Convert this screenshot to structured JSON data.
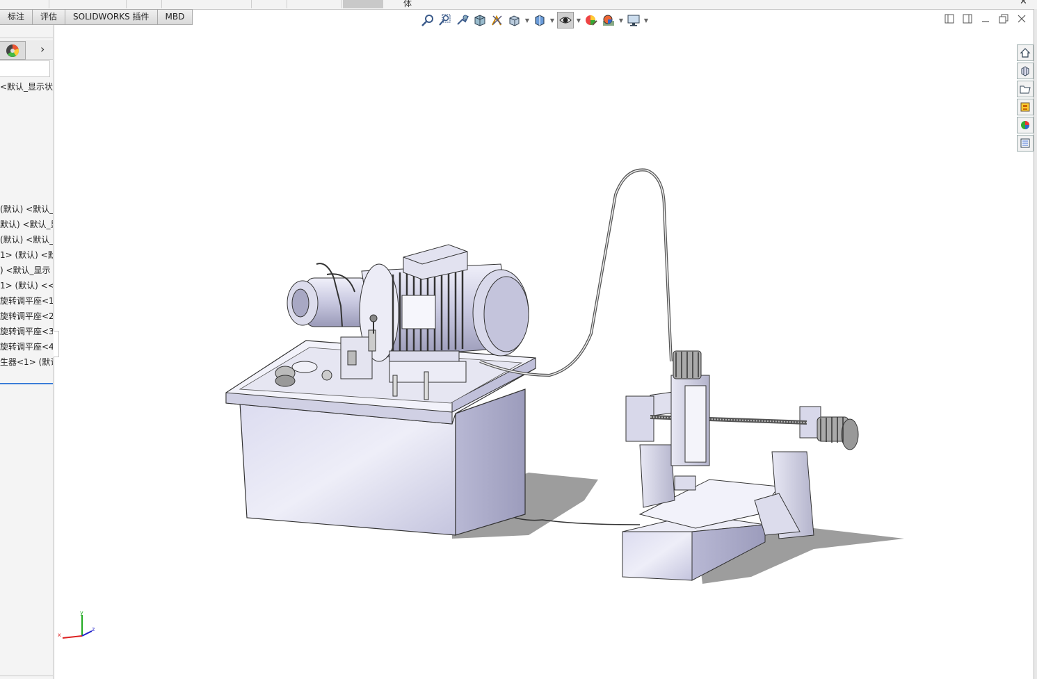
{
  "tabs": [
    "标注",
    "评估",
    "SOLIDWORKS 插件",
    "MBD"
  ],
  "top_strip_char": "体",
  "tree_top": "<默认_显示状",
  "tree_rows": [
    "(默认) <默认_显",
    "默认) <默认_显",
    "(默认) <默认_显",
    "1> (默认) <默",
    ") <默认_显示",
    "1> (默认) <<",
    "旋转调平座<1",
    "旋转调平座<2",
    "旋转调平座<3",
    "旋转调平座<4",
    "生器<1> (默认"
  ],
  "triad": {
    "x": "x",
    "y": "y",
    "z": "z"
  },
  "icons": {
    "hud": [
      "zoom-to-fit-icon",
      "zoom-area-icon",
      "previous-view-icon",
      "section-view-icon",
      "dynamic-annotation-icon",
      "view-orientation-icon",
      "display-style-icon",
      "hide-show-icon",
      "edit-appearance-icon",
      "apply-scene-icon",
      "view-settings-icon"
    ],
    "taskpane": [
      "home-icon",
      "resources-icon",
      "file-explorer-icon",
      "view-palette-icon",
      "appearances-icon",
      "custom-properties-icon"
    ]
  }
}
